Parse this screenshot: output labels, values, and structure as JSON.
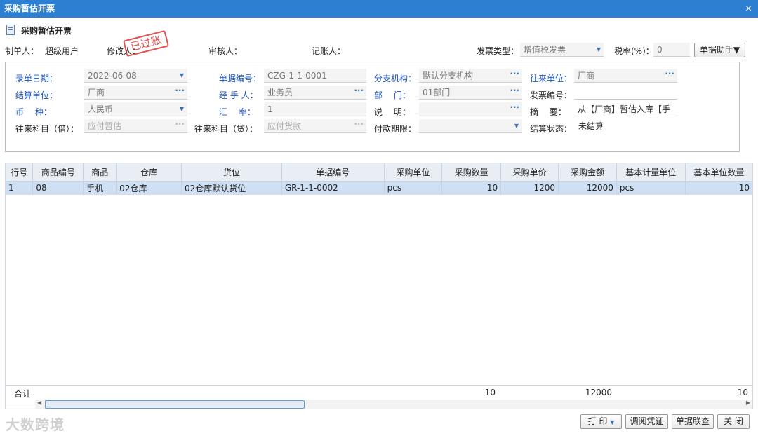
{
  "window": {
    "title": "采购暂估开票",
    "close": "×"
  },
  "page_title": "采购暂估开票",
  "meta": {
    "maker_label": "制单人：",
    "maker_value": "超级用户",
    "modifier_label": "修改人：",
    "auditor_label": "审核人：",
    "poster_label": "记账人：",
    "stamp": "已过账",
    "invoice_type_label": "发票类型：",
    "invoice_type_value": "增值税发票",
    "tax_rate_label": "税率(%)：",
    "tax_rate_value": "0",
    "helper_button": "单据助手▼"
  },
  "form": {
    "entry_date": {
      "label": "录单日期：",
      "value": "2022-06-08"
    },
    "doc_no": {
      "label": "单据编号：",
      "value": "CZG-1-1-0001"
    },
    "branch": {
      "label": "分支机构：",
      "value": "默认分支机构"
    },
    "partner": {
      "label": "往来单位：",
      "value": "厂商"
    },
    "settle_unit": {
      "label": "结算单位：",
      "value": "厂商"
    },
    "handler": {
      "label": "经 手 人：",
      "value": "业务员"
    },
    "dept": {
      "label": "部　 门：",
      "value": "01部门"
    },
    "invoice_no": {
      "label": "发票编号：",
      "value": ""
    },
    "currency": {
      "label": "币　 种：",
      "value": "人民币"
    },
    "rate": {
      "label": "汇　 率：",
      "value": "1"
    },
    "note": {
      "label": "说　 明：",
      "value": ""
    },
    "summary": {
      "label": "摘　 要：",
      "value": "从【厂商】暂估入库【手"
    },
    "debit_acct": {
      "label": "往来科目（借）：",
      "value": "应付暂估"
    },
    "credit_acct": {
      "label": "往来科目（贷）：",
      "value": "应付货款"
    },
    "pay_term": {
      "label": "付款期限：",
      "value": ""
    },
    "settle_status": {
      "label": "结算状态：",
      "value": "未结算"
    }
  },
  "table": {
    "headers": [
      "行号",
      "商品编号",
      "商品",
      "仓库",
      "货位",
      "单据编号",
      "采购单位",
      "采购数量",
      "采购单价",
      "采购金额",
      "基本计量单位",
      "基本单位数量"
    ],
    "rows": [
      [
        "1",
        "08",
        "手机",
        "02仓库",
        "02仓库默认货位",
        "GR-1-1-0002",
        "pcs",
        "10",
        "1200",
        "12000",
        "pcs",
        "10"
      ]
    ],
    "totals_label": "合计",
    "totals": {
      "qty": "10",
      "amount": "12000",
      "base_qty": "10"
    }
  },
  "buttons": {
    "print": "打 印",
    "dropdown_arrow": "▼",
    "voucher": "调阅凭证",
    "linked": "单据联查",
    "close": "关 闭"
  },
  "watermark": "大数跨境"
}
